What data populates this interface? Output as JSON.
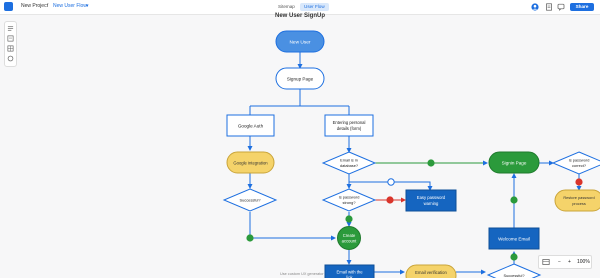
{
  "header": {
    "project": "New Project",
    "separator": "/",
    "flow_name": "New User Flow",
    "tabs": [
      {
        "label": "Sitemap",
        "active": false
      },
      {
        "label": "User Flow",
        "active": true
      }
    ],
    "share_label": "Share"
  },
  "canvas": {
    "title": "New User SignUp",
    "footer_text": "Use custom UX generator"
  },
  "zoom": {
    "level": "100%",
    "minus": "−",
    "plus": "+"
  },
  "nodes": {
    "new_user": "New User",
    "signup_page": "Signup Page",
    "google_auth": "Google Auth",
    "entering_details": [
      "Entering personal",
      "details (form)"
    ],
    "google_integration": "Google integration",
    "email_in_db": [
      "Email is in",
      "database?"
    ],
    "signin_page": "Signin Page",
    "password_correct": [
      "Is password",
      "correct?"
    ],
    "successful_1": "Successful?",
    "password_strong": [
      "Is password",
      "strong?"
    ],
    "easy_password": [
      "Easy password",
      "warning"
    ],
    "restore_password": [
      "Restore password",
      "process"
    ],
    "create_account": [
      "Create",
      "account"
    ],
    "welcome_email": "Welcome Email",
    "email_with_link": [
      "Email with the",
      "link"
    ],
    "email_verification": "Email verification",
    "successful_2": "Successful?"
  },
  "colors": {
    "accent": "#1d6fe0",
    "green": "#2b9a3b",
    "red": "#d9342b",
    "yellow": "#f5d36a",
    "edge": "#1d6fe0"
  }
}
